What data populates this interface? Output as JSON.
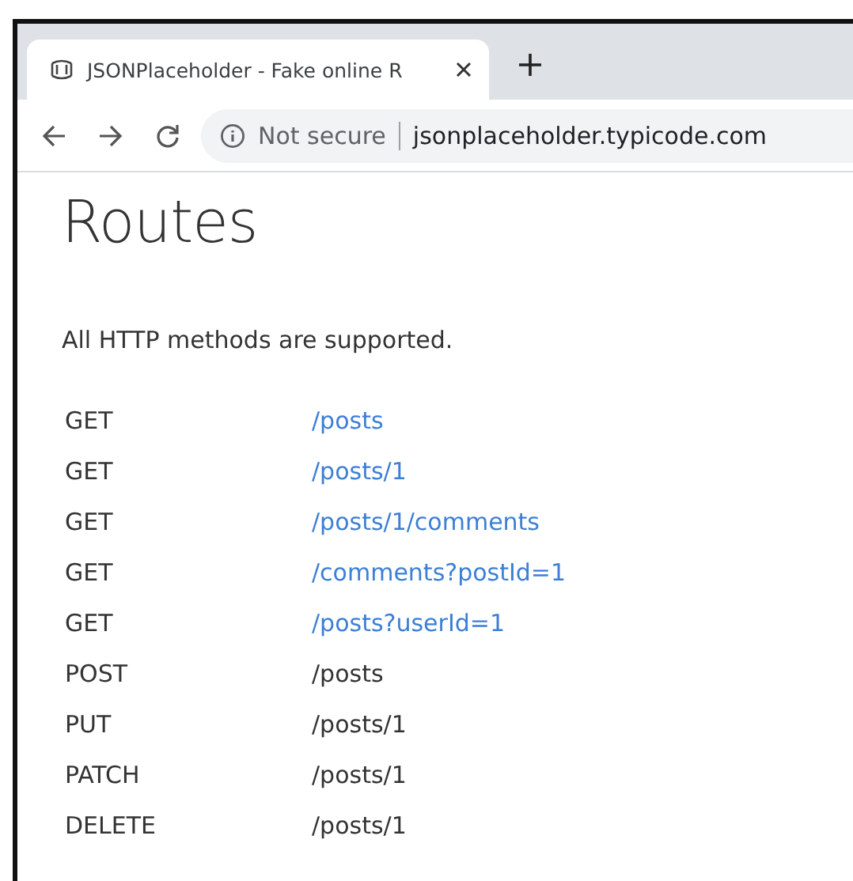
{
  "browser": {
    "tab": {
      "title": "JSONPlaceholder - Fake online R",
      "selected": true
    },
    "address": {
      "security": "Not secure",
      "url": "jsonplaceholder.typicode.com"
    }
  },
  "page": {
    "heading": "Routes",
    "intro": "All HTTP methods are supported.",
    "routes": [
      {
        "method": "GET",
        "path": "/posts",
        "kind": "link"
      },
      {
        "method": "GET",
        "path": "/posts/1",
        "kind": "link"
      },
      {
        "method": "GET",
        "path": "/posts/1/comments",
        "kind": "link"
      },
      {
        "method": "GET",
        "path": "/comments?postId=1",
        "kind": "link"
      },
      {
        "method": "GET",
        "path": "/posts?userId=1",
        "kind": "link"
      },
      {
        "method": "POST",
        "path": "/posts",
        "kind": "text"
      },
      {
        "method": "PUT",
        "path": "/posts/1",
        "kind": "text"
      },
      {
        "method": "PATCH",
        "path": "/posts/1",
        "kind": "text"
      },
      {
        "method": "DELETE",
        "path": "/posts/1",
        "kind": "text"
      }
    ]
  }
}
